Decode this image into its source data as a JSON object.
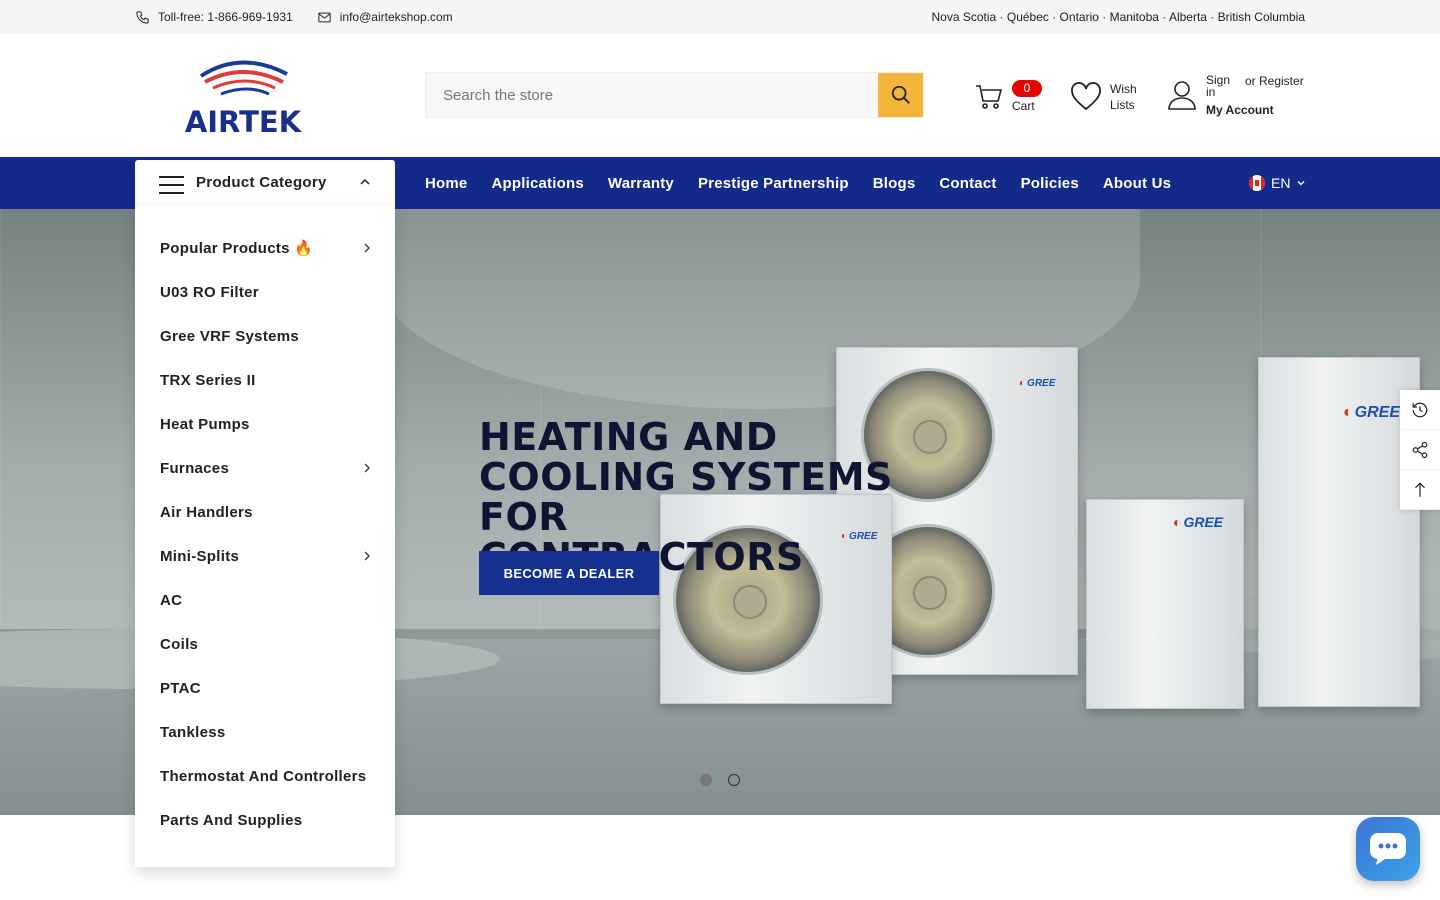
{
  "topbar": {
    "phone": "Toll-free: 1-866-969-1931",
    "email": "info@airtekshop.com",
    "regions": "Nova Scotia · Québec · Ontario · Manitoba · Alberta · British Columbia"
  },
  "header": {
    "logo_text": "AIRTEK",
    "search_placeholder": "Search the store",
    "cart_count": "0",
    "cart_label": "Cart",
    "wish_label": "Wish Lists",
    "sign_in": "Sign in",
    "register": "or Register",
    "my_account": "My Account"
  },
  "nav": {
    "category_label": "Product Category",
    "links": [
      "Home",
      "Applications",
      "Warranty",
      "Prestige Partnership",
      "Blogs",
      "Contact",
      "Policies",
      "About Us"
    ],
    "language": "EN"
  },
  "categories": [
    {
      "label": "Popular Products 🔥",
      "has_sub": true
    },
    {
      "label": "U03 RO Filter",
      "has_sub": false
    },
    {
      "label": "Gree VRF Systems",
      "has_sub": false
    },
    {
      "label": "TRX Series II",
      "has_sub": false
    },
    {
      "label": "Heat Pumps",
      "has_sub": false
    },
    {
      "label": "Furnaces",
      "has_sub": true
    },
    {
      "label": "Air Handlers",
      "has_sub": false
    },
    {
      "label": "Mini-Splits",
      "has_sub": true
    },
    {
      "label": "AC",
      "has_sub": false
    },
    {
      "label": "Coils",
      "has_sub": false
    },
    {
      "label": "PTAC",
      "has_sub": false
    },
    {
      "label": "Tankless",
      "has_sub": false
    },
    {
      "label": "Thermostat And Controllers",
      "has_sub": false
    },
    {
      "label": "Parts And Supplies",
      "has_sub": false
    }
  ],
  "hero": {
    "title_line1": "HEATING AND",
    "title_line2": "COOLING SYSTEMS",
    "title_line3": "FOR CONTRACTORS",
    "cta": "BECOME A DEALER",
    "brand_mark": "GREE"
  },
  "colors": {
    "nav_bg": "#142a8a",
    "search_button": "#f4b63a",
    "cart_badge": "#e10600",
    "cta_bg": "#16308f"
  }
}
